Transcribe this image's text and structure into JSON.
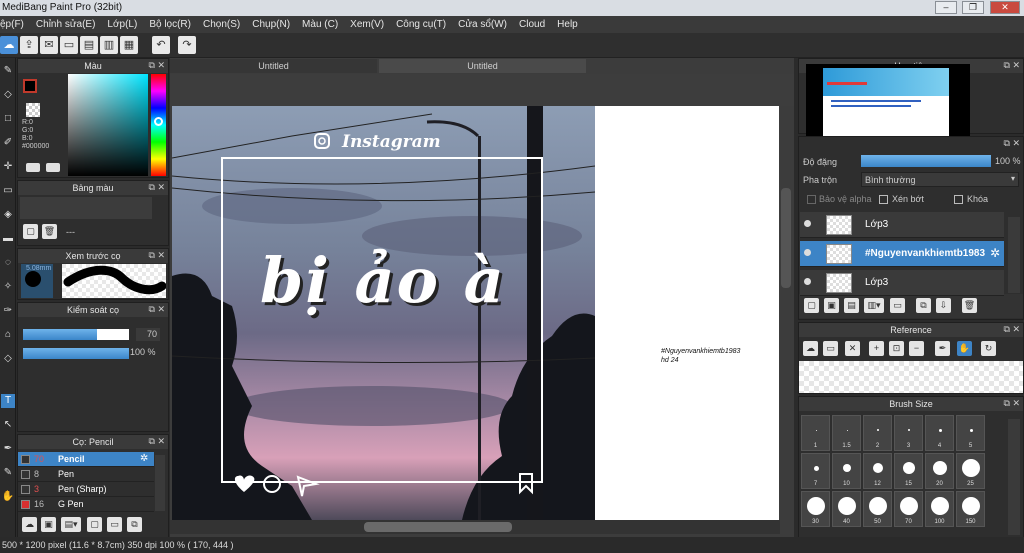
{
  "window": {
    "title": "MediBang Paint Pro (32bit)",
    "controls": [
      "–",
      "❐",
      "✕"
    ]
  },
  "menu": [
    "ệp(F)",
    "Chỉnh sửa(E)",
    "Lớp(L)",
    "Bộ lọc(R)",
    "Chọn(S)",
    "Chụp(N)",
    "Màu (C)",
    "Xem(V)",
    "Công cụ(T)",
    "Cửa sổ(W)",
    "Cloud",
    "Help"
  ],
  "tabs": [
    "Untitled",
    "Untitled"
  ],
  "color_panel": {
    "title": "Màu",
    "r": "R:0",
    "g": "G:0",
    "b": "B:0",
    "hex": "#000000",
    "fg": "#8b0d0d",
    "bg": "#ffffff"
  },
  "palette_panel": {
    "title": "Bảng màu",
    "name": "---"
  },
  "brush_preview": {
    "title": "Xem trước cọ",
    "size": "5.08mm"
  },
  "brush_control": {
    "title": "Kiểm soát cọ",
    "size_value": "70",
    "opacity_value": "100 %",
    "size_level": 0.7,
    "opacity_level": 1.0
  },
  "brush_list": {
    "title": "Cọ: Pencil",
    "items": [
      {
        "size": "70",
        "name": "Pencil",
        "color": "#e05050",
        "selected": true
      },
      {
        "size": "8",
        "name": "Pen",
        "color": "#bbbbbb",
        "selected": false
      },
      {
        "size": "3",
        "name": "Pen (Sharp)",
        "color": "#e05050",
        "selected": false
      },
      {
        "size": "16",
        "name": "G Pen",
        "color": "#bbbbbb",
        "selected": false
      }
    ]
  },
  "artwork": {
    "brand": "Instagram",
    "headline": "bị ảo à",
    "side_text_1": "#Nguyenvankhiemtb1983",
    "side_text_2": "hd 24"
  },
  "navigator": {
    "title": "Hoa tiêu"
  },
  "layer_panel": {
    "opacity_label": "Độ đặng",
    "opacity_value": "100 %",
    "blend_label": "Pha trộn",
    "blend_value": "Bình thường",
    "protect_alpha": "Bảo vệ alpha",
    "clip": "Xén bớt",
    "lock": "Khóa",
    "layers": [
      {
        "name": "Lớp3",
        "selected": false
      },
      {
        "name": "#Nguyenvankhiemtb1983",
        "selected": true
      },
      {
        "name": "Lớp3",
        "selected": false
      }
    ]
  },
  "reference": {
    "title": "Reference"
  },
  "brush_size": {
    "title": "Brush Size",
    "labels_row1": [
      "1",
      "1.5",
      "2",
      "3",
      "4",
      "5"
    ],
    "labels_row2": [
      "7",
      "10",
      "12",
      "15",
      "20",
      "25"
    ],
    "labels_row3": [
      "30",
      "40",
      "50",
      "70",
      "100",
      "150"
    ]
  },
  "status": {
    "text": "500 * 1200 pixel   (11.6 * 8.7cm)   350 dpi   100 %   ( 170, 444 )"
  }
}
